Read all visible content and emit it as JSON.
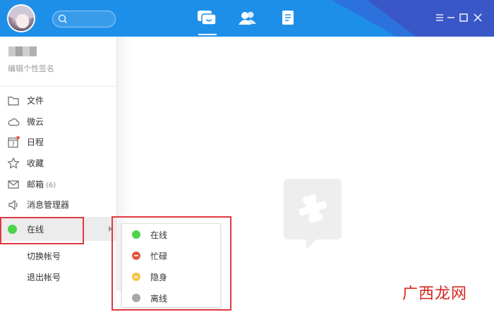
{
  "header": {
    "search_placeholder": "",
    "nav": [
      "chat-icon",
      "contacts-icon",
      "notes-icon"
    ]
  },
  "profile": {
    "signature": "编辑个性签名"
  },
  "sidebar": {
    "items": [
      {
        "label": "文件",
        "icon": "folder-icon"
      },
      {
        "label": "微云",
        "icon": "cloud-icon"
      },
      {
        "label": "日程",
        "icon": "calendar-icon",
        "calendar_day": "7"
      },
      {
        "label": "收藏",
        "icon": "star-icon"
      },
      {
        "label": "邮箱",
        "icon": "mail-icon",
        "count": "(6)"
      },
      {
        "label": "消息管理器",
        "icon": "speaker-icon"
      }
    ],
    "status": {
      "label": "在线",
      "color": "#4cd34b"
    },
    "switch_account": "切换帐号",
    "logout": "退出帐号"
  },
  "status_menu": [
    {
      "label": "在线",
      "color": "#4cd34b"
    },
    {
      "label": "忙碌",
      "color": "#e5533c"
    },
    {
      "label": "隐身",
      "color": "#f2c13d"
    },
    {
      "label": "离线",
      "color": "#a8a8a8"
    }
  ],
  "watermark": "广西龙网",
  "colors": {
    "titlebar": "#1e8fe9",
    "highlight_box": "#e0393e"
  }
}
